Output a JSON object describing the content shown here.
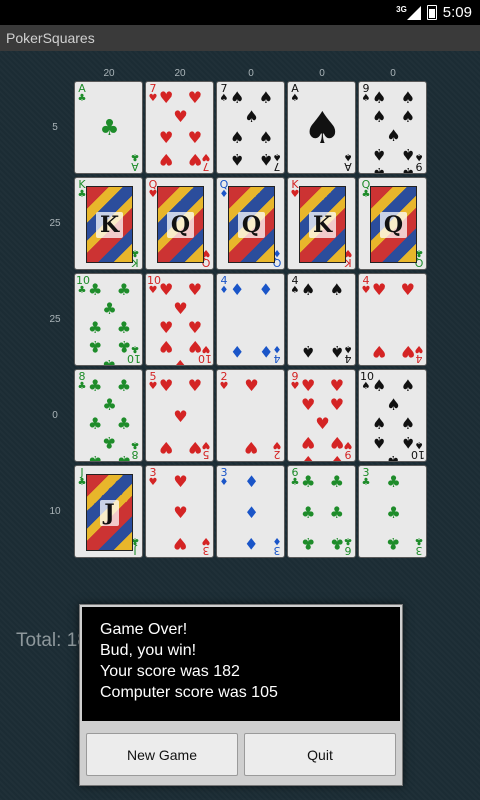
{
  "status_bar": {
    "network": "3G",
    "time": "5:09"
  },
  "app_title": "PokerSquares",
  "column_scores": [
    "20",
    "20",
    "0",
    "0",
    "0"
  ],
  "row_scores": [
    "5",
    "25",
    "25",
    "0",
    "10"
  ],
  "grid": [
    [
      {
        "rank": "A",
        "suit": "♣",
        "color": "green",
        "pips": 1
      },
      {
        "rank": "7",
        "suit": "♥",
        "color": "red",
        "pips": 7
      },
      {
        "rank": "7",
        "suit": "♠",
        "color": "black",
        "pips": 7
      },
      {
        "rank": "A",
        "suit": "♠",
        "color": "black",
        "pips": 1
      },
      {
        "rank": "9",
        "suit": "♠",
        "color": "black",
        "pips": 9
      }
    ],
    [
      {
        "rank": "K",
        "suit": "♣",
        "color": "green",
        "face": true
      },
      {
        "rank": "Q",
        "suit": "♥",
        "color": "red",
        "face": true
      },
      {
        "rank": "Q",
        "suit": "♦",
        "color": "blue",
        "face": true
      },
      {
        "rank": "K",
        "suit": "♥",
        "color": "red",
        "face": true
      },
      {
        "rank": "Q",
        "suit": "♣",
        "color": "green",
        "face": true
      }
    ],
    [
      {
        "rank": "10",
        "suit": "♣",
        "color": "green",
        "pips": 10
      },
      {
        "rank": "10",
        "suit": "♥",
        "color": "red",
        "pips": 10
      },
      {
        "rank": "4",
        "suit": "♦",
        "color": "blue",
        "pips": 4
      },
      {
        "rank": "4",
        "suit": "♠",
        "color": "black",
        "pips": 4
      },
      {
        "rank": "4",
        "suit": "♥",
        "color": "red",
        "pips": 4
      }
    ],
    [
      {
        "rank": "8",
        "suit": "♣",
        "color": "green",
        "pips": 8
      },
      {
        "rank": "5",
        "suit": "♥",
        "color": "red",
        "pips": 5
      },
      {
        "rank": "2",
        "suit": "♥",
        "color": "red",
        "pips": 2
      },
      {
        "rank": "9",
        "suit": "♥",
        "color": "red",
        "pips": 9
      },
      {
        "rank": "10",
        "suit": "♠",
        "color": "black",
        "pips": 10
      }
    ],
    [
      {
        "rank": "J",
        "suit": "♣",
        "color": "green",
        "face": true
      },
      {
        "rank": "3",
        "suit": "♥",
        "color": "red",
        "pips": 3
      },
      {
        "rank": "3",
        "suit": "♦",
        "color": "blue",
        "pips": 3
      },
      {
        "rank": "6",
        "suit": "♣",
        "color": "green",
        "pips": 6
      },
      {
        "rank": "3",
        "suit": "♣",
        "color": "green",
        "pips": 3
      }
    ]
  ],
  "total_label": "Total: 18",
  "dialog": {
    "lines": [
      "Game Over!",
      "Bud, you win!",
      "Your score was 182",
      "Computer score was 105"
    ],
    "new_game_label": "New Game",
    "quit_label": "Quit"
  }
}
